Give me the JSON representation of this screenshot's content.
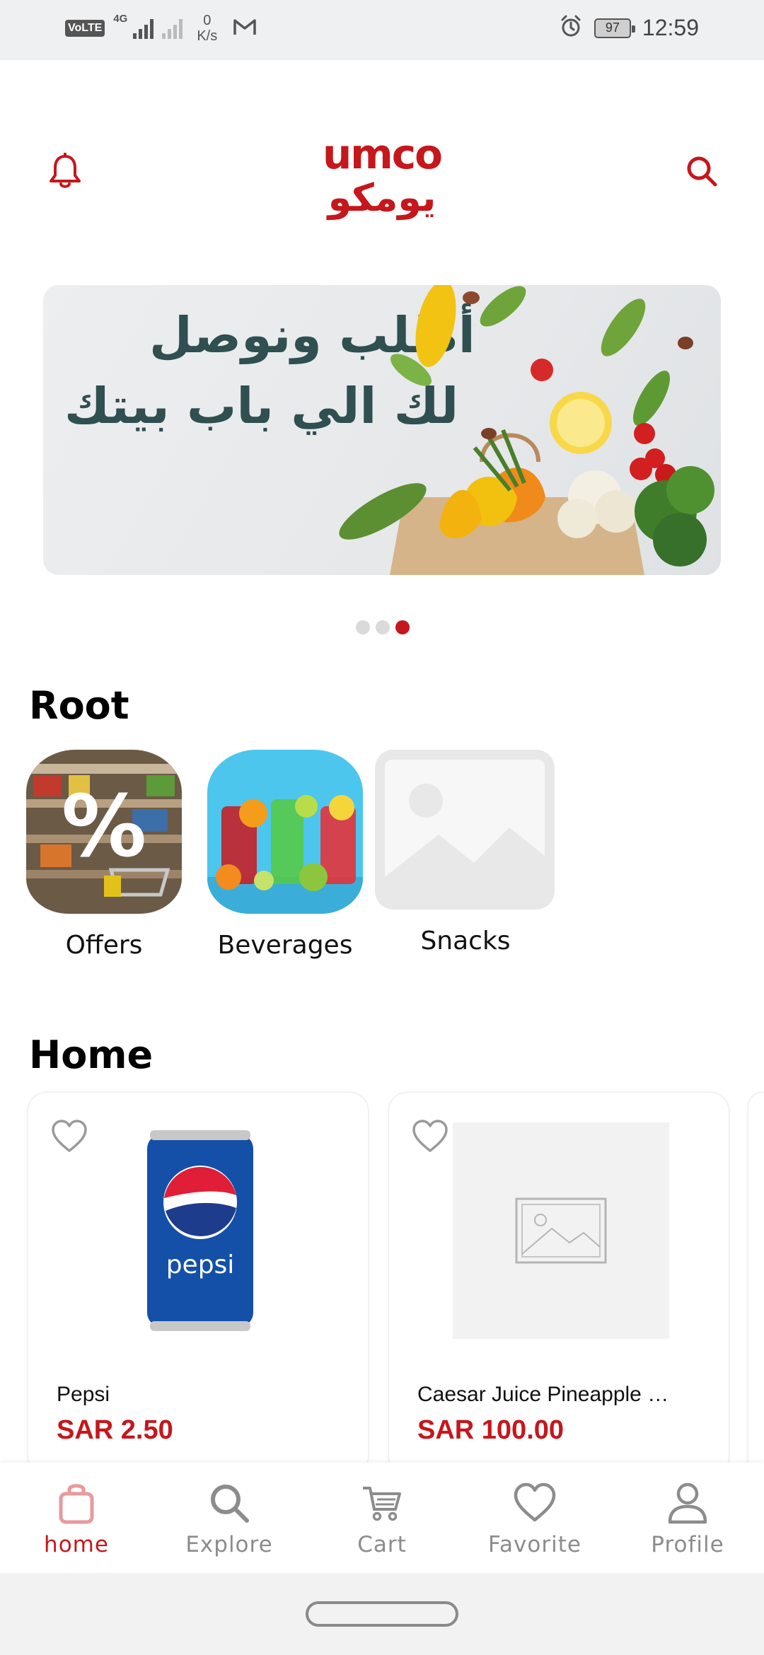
{
  "status_bar": {
    "volte": "VoLTE",
    "network": "4G",
    "speed_value": "0",
    "speed_unit": "K/s",
    "battery": "97",
    "time": "12:59"
  },
  "header": {
    "logo_latin": "umco",
    "logo_arabic": "يومكو",
    "icons": {
      "left": "bell-icon",
      "right": "search-icon"
    }
  },
  "banner": {
    "line1": "أطلب ونوصل",
    "line2": "لك الي باب بيتك",
    "slides_total": 3,
    "active_slide": 3
  },
  "root_section": {
    "title": "Root",
    "categories": [
      {
        "label": "Offers"
      },
      {
        "label": "Beverages"
      },
      {
        "label": "Snacks"
      }
    ]
  },
  "home_section": {
    "title": "Home",
    "products": [
      {
        "name": "Pepsi",
        "price": "SAR 2.50",
        "brand_text": "pepsi"
      },
      {
        "name": "Caesar Juice Pineapple …",
        "price": "SAR 100.00"
      }
    ]
  },
  "bottom_nav": [
    {
      "label": "home",
      "icon": "shopping-bag-icon",
      "active": true
    },
    {
      "label": "Explore",
      "icon": "search-icon",
      "active": false
    },
    {
      "label": "Cart",
      "icon": "cart-icon",
      "active": false
    },
    {
      "label": "Favorite",
      "icon": "heart-icon",
      "active": false
    },
    {
      "label": "Profile",
      "icon": "person-icon",
      "active": false
    }
  ],
  "colors": {
    "brand_red": "#c5171c",
    "banner_text": "#2f4f50",
    "inactive_nav": "#8c8c8c"
  }
}
